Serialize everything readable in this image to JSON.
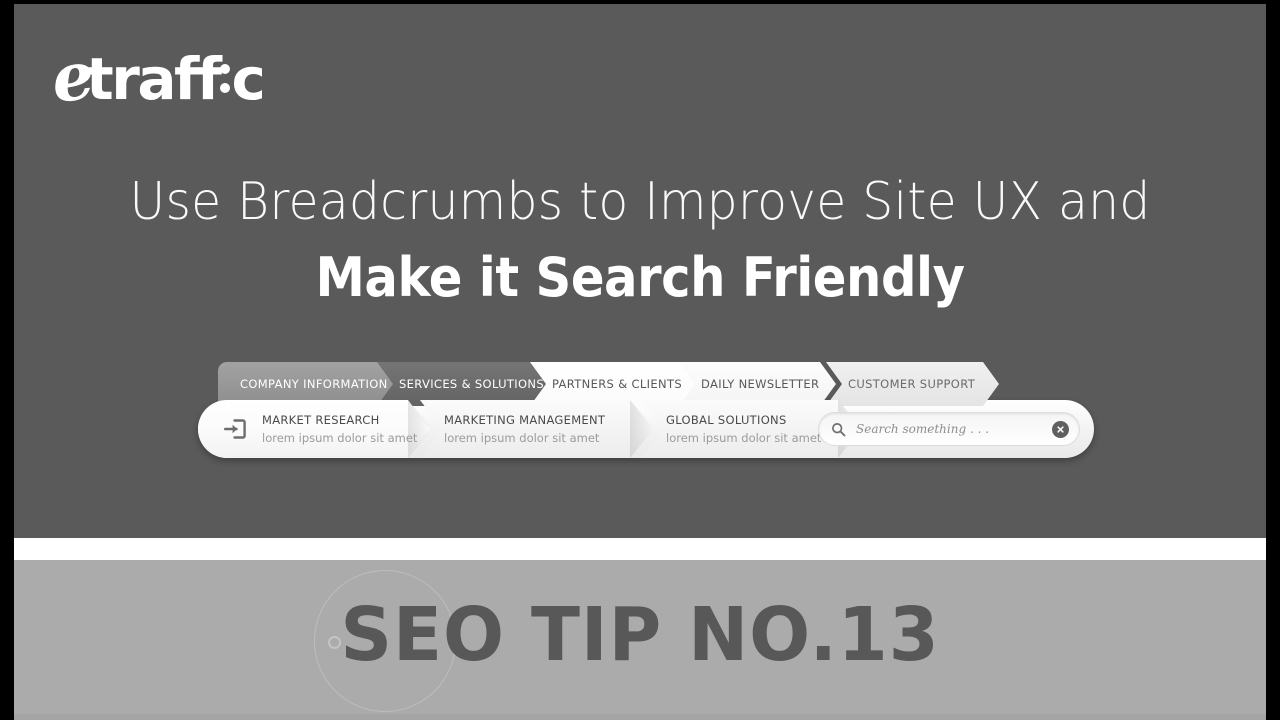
{
  "brand": {
    "logo_e": "e",
    "logo_word": "traff",
    "logo_tail": "c",
    "logo_alt": "etraffic"
  },
  "headline": {
    "line1": "Use Breadcrumbs to Improve Site UX and",
    "line2": "Make it Search Friendly"
  },
  "breadcrumb": {
    "tabs": [
      {
        "label": "COMPANY INFORMATION",
        "state": "inactive"
      },
      {
        "label": "SERVICES & SOLUTIONS",
        "state": "active"
      },
      {
        "label": "PARTNERS & CLIENTS",
        "state": "inactive"
      },
      {
        "label": "DAILY NEWSLETTER",
        "state": "inactive"
      },
      {
        "label": "CUSTOMER SUPPORT",
        "state": "inactive"
      }
    ],
    "crumbs": [
      {
        "title": "MARKET RESEARCH",
        "subtitle": "lorem ipsum dolor sit amet",
        "icon": "login-arrow-icon"
      },
      {
        "title": "MARKETING MANAGEMENT",
        "subtitle": "lorem ipsum dolor sit amet"
      },
      {
        "title": "GLOBAL SOLUTIONS",
        "subtitle": "lorem ipsum dolor sit amet"
      }
    ],
    "search": {
      "placeholder": "Search something . . .",
      "value": "",
      "icon": "search-icon",
      "clear_icon": "clear-circle-icon"
    }
  },
  "banner": {
    "title": "SEO TIP NO.13"
  },
  "colors": {
    "top_background": "#5a5a5a",
    "banner_background": "#ababab",
    "banner_text": "#585858",
    "divider": "#ffffff",
    "frame": "#000000",
    "tab_active": "#6b6b6b",
    "tab_inactive": "#979797"
  }
}
